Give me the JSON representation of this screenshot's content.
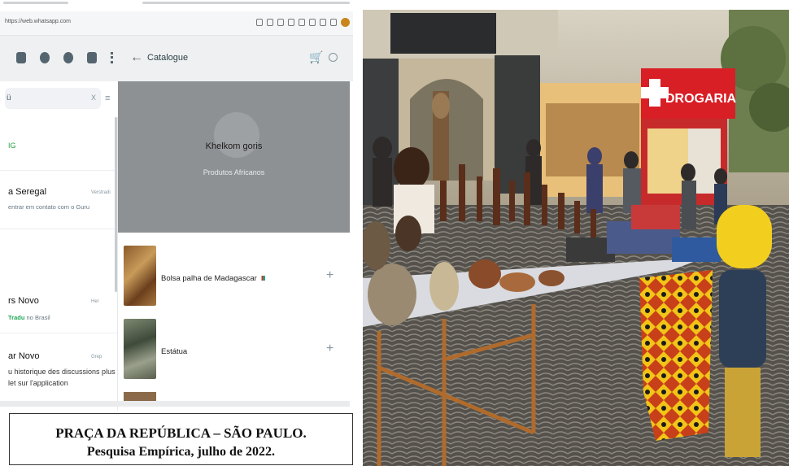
{
  "browser": {
    "url": "https://web.whatsapp.com"
  },
  "app": {
    "panel_title": "Catalogue",
    "search_query": "ü",
    "search_clear": "X"
  },
  "chats": [
    {
      "name": "",
      "message": "",
      "label": "IG"
    },
    {
      "name": "a Seregal",
      "time": "Verstradi",
      "message": "entrar em contato com o Guru"
    },
    {
      "name": "rs Novo",
      "time": "Her",
      "message": "no Brasil",
      "highlight": "Tradu"
    },
    {
      "name": "ar Novo",
      "time": "Grep",
      "message": ""
    }
  ],
  "info_text": [
    "u historique des discussions plus",
    "let sur l'application"
  ],
  "business": {
    "name": "Khelkom goris",
    "subtitle": "Produtos Africanos"
  },
  "catalogue": [
    {
      "name": "Bolsa palha de Madagascar"
    },
    {
      "name": "Estátua"
    }
  ],
  "caption": {
    "line1": "PRAÇA DA REPÚBLICA – SÃO PAULO.",
    "line2": "Pesquisa Empírica, julho de 2022."
  },
  "photo": {
    "store_sign": "DROGARIA"
  },
  "colors": {
    "appbar": "#eef0f1",
    "banner": "#8e9194",
    "sign_red": "#d81f26",
    "icon": "#54656f"
  }
}
